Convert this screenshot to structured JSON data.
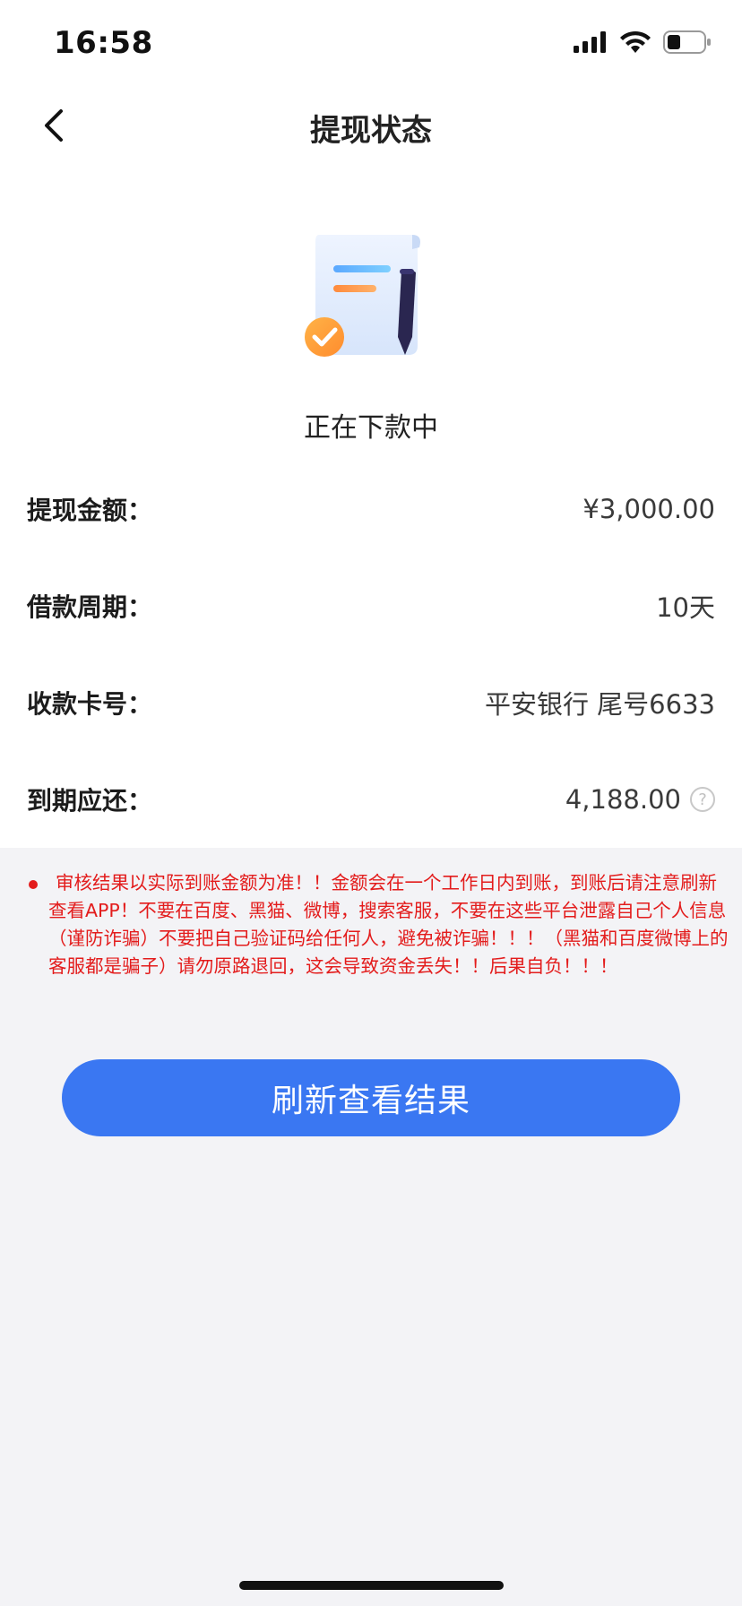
{
  "status_bar": {
    "time": "16:58"
  },
  "nav": {
    "title": "提现状态",
    "back_icon": "chevron-left-icon"
  },
  "status": {
    "icon": "document-pen-check-icon",
    "message": "正在下款中"
  },
  "details": [
    {
      "label": "提现金额：",
      "value": "¥3,000.00"
    },
    {
      "label": "借款周期：",
      "value": "10天"
    },
    {
      "label": "收款卡号：",
      "value": "平安银行 尾号6633"
    },
    {
      "label": "到期应还：",
      "value": "4,188.00",
      "help_icon": "question-circle-icon"
    }
  ],
  "notice": {
    "text": "审核结果以实际到账金额为准！！金额会在一个工作日内到账，到账后请注意刷新查看APP！不要在百度、黑猫、微博，搜索客服，不要在这些平台泄露自己个人信息（谨防诈骗）不要把自己验证码给任何人，避免被诈骗！！！（黑猫和百度微博上的客服都是骗子）请勿原路退回，这会导致资金丢失！！后果自负！！！",
    "color": "#e31c1c"
  },
  "actions": {
    "refresh_label": "刷新查看结果",
    "accent_color": "#3a77f2"
  }
}
